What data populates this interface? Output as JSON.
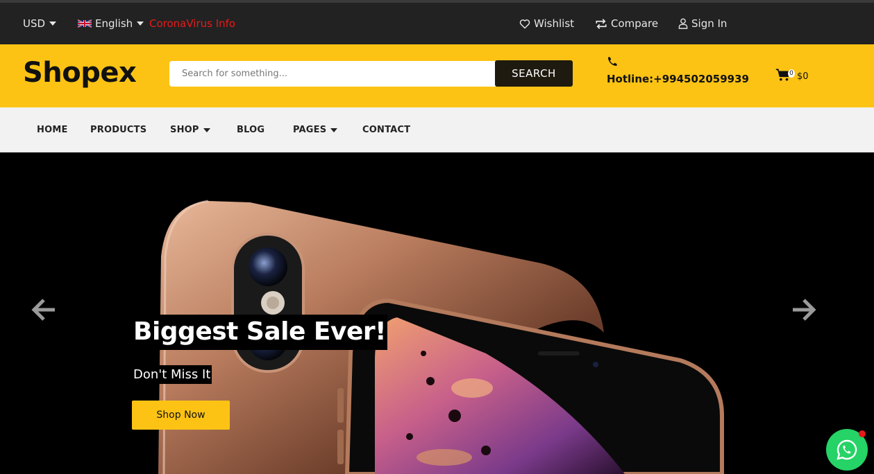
{
  "topbar": {
    "currency": "USD",
    "language": "English",
    "info_link": "CoronaVirus Info",
    "wishlist": "Wishlist",
    "compare": "Compare",
    "sign_in": "Sign In"
  },
  "header": {
    "logo": "Shopex",
    "search_placeholder": "Search for something...",
    "search_button": "SEARCH",
    "hotline": "Hotline:+994502059939",
    "cart_count": "0",
    "cart_total": "$0"
  },
  "nav": {
    "items": [
      {
        "label": "HOME"
      },
      {
        "label": "PRODUCTS"
      },
      {
        "label": "SHOP"
      },
      {
        "label": "BLOG"
      },
      {
        "label": "PAGES"
      },
      {
        "label": "CONTACT"
      }
    ]
  },
  "hero": {
    "title": "Biggest Sale Ever!",
    "subtitle": "Don't Miss It",
    "button": "Shop Now"
  },
  "colors": {
    "accent": "#fcc315",
    "topbar": "#222222",
    "alert": "#e81a1a",
    "whatsapp": "#25d366"
  },
  "icons": [
    "caret-down-icon",
    "uk-flag-icon",
    "heart-icon",
    "compare-icon",
    "user-icon",
    "phone-icon",
    "cart-icon",
    "arrow-left-icon",
    "arrow-right-icon",
    "whatsapp-icon"
  ]
}
